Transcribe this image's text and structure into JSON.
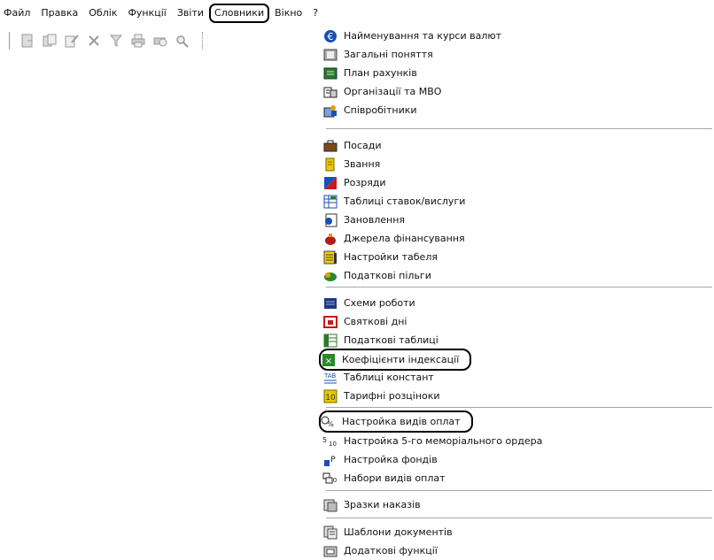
{
  "menubar": {
    "items": [
      "Файл",
      "Правка",
      "Облік",
      "Функції",
      "Звіти",
      "Словники",
      "Вікно",
      "?"
    ]
  },
  "toolbar": {
    "buttons": [
      "new-doc-icon",
      "copy-doc-icon",
      "edit-doc-icon",
      "delete-icon",
      "filter-icon",
      "print-icon",
      "print-preview-icon",
      "find-icon"
    ]
  },
  "dropdown": {
    "items": [
      {
        "label": "Найменування та курси валют",
        "icon": "currency-euro-icon",
        "color": "#1a4fb5"
      },
      {
        "label": "Загальні поняття",
        "icon": "book-icon",
        "color": "#6b6b6b"
      },
      {
        "label": "План рахунків",
        "icon": "ledger-icon",
        "color": "#2a7a2a"
      },
      {
        "label": "Організації та МВО",
        "icon": "organization-icon",
        "color": "#333333"
      },
      {
        "label": "Співробітники",
        "icon": "employees-icon",
        "color": "#1a4fb5"
      },
      {
        "label": "Посади",
        "icon": "briefcase-icon",
        "color": "#7a4a1a"
      },
      {
        "label": "Звання",
        "icon": "rank-icon",
        "color": "#c8a800"
      },
      {
        "label": "Розряди",
        "icon": "grades-icon",
        "color": "#c81a1a"
      },
      {
        "label": "Таблиці ставок/вислуги",
        "icon": "rates-table-icon",
        "color": "#1a4fb5"
      },
      {
        "label": "Зановлення",
        "icon": "renewal-icon",
        "color": "#1a4fb5"
      },
      {
        "label": "Джерела фінансування",
        "icon": "money-bag-icon",
        "color": "#b51a1a"
      },
      {
        "label": "Настройки табеля",
        "icon": "timesheet-icon",
        "color": "#c8a800"
      },
      {
        "label": "Податкові пільги",
        "icon": "tax-benefit-icon",
        "color": "#2a8a2a"
      },
      {
        "label": "Схеми роботи",
        "icon": "schedule-icon",
        "color": "#1a3a8a"
      },
      {
        "label": "Святкові дні",
        "icon": "calendar-icon",
        "color": "#c81a1a"
      },
      {
        "label": "Податкові таблиці",
        "icon": "tax-table-icon",
        "color": "#2a7a2a"
      },
      {
        "label": "Коефіцієнти індексації",
        "icon": "coefficient-icon",
        "color": "#2a8a2a"
      },
      {
        "label": "Таблиці констант",
        "icon": "constants-icon",
        "color": "#1a4fb5"
      },
      {
        "label": "Тарифні розціноки",
        "icon": "tariff-icon",
        "color": "#c8a800"
      },
      {
        "label": "Настройка видів оплат",
        "icon": "payment-types-icon",
        "color": "#222222"
      },
      {
        "label": "Настройка 5-го меморіального ордера",
        "icon": "memorial-order-icon",
        "color": "#222222"
      },
      {
        "label": "Настройка фондів",
        "icon": "funds-icon",
        "color": "#1a4fb5"
      },
      {
        "label": "Набори видів оплат",
        "icon": "payment-sets-icon",
        "color": "#222222"
      },
      {
        "label": "Зразки наказів",
        "icon": "orders-samples-icon",
        "color": "#555555"
      },
      {
        "label": "Шаблони документів",
        "icon": "templates-icon",
        "color": "#555555"
      },
      {
        "label": "Додаткові функції",
        "icon": "extra-functions-icon",
        "color": "#555555"
      }
    ]
  },
  "highlight_color": "#000000"
}
